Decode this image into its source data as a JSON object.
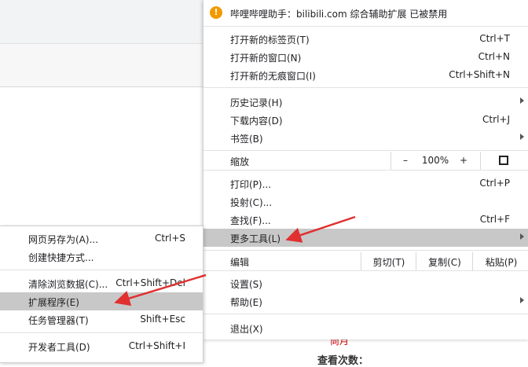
{
  "warning": {
    "text": "哔哩哔哩助手：bilibili.com 综合辅助扩展 已被禁用"
  },
  "menu": {
    "new_tab": {
      "label": "打开新的标签页(T)",
      "shortcut": "Ctrl+T"
    },
    "new_window": {
      "label": "打开新的窗口(N)",
      "shortcut": "Ctrl+N"
    },
    "new_incognito": {
      "label": "打开新的无痕窗口(I)",
      "shortcut": "Ctrl+Shift+N"
    },
    "history": {
      "label": "历史记录(H)"
    },
    "downloads": {
      "label": "下载内容(D)",
      "shortcut": "Ctrl+J"
    },
    "bookmarks": {
      "label": "书签(B)"
    },
    "zoom": {
      "label": "缩放",
      "minus": "–",
      "value": "100%",
      "plus": "+"
    },
    "print": {
      "label": "打印(P)...",
      "shortcut": "Ctrl+P"
    },
    "cast": {
      "label": "投射(C)..."
    },
    "find": {
      "label": "查找(F)...",
      "shortcut": "Ctrl+F"
    },
    "more_tools": {
      "label": "更多工具(L)"
    },
    "edit": {
      "label": "编辑",
      "cut": "剪切(T)",
      "copy": "复制(C)",
      "paste": "粘贴(P)"
    },
    "settings": {
      "label": "设置(S)"
    },
    "help": {
      "label": "帮助(E)"
    },
    "exit": {
      "label": "退出(X)"
    }
  },
  "submenu": {
    "save_page": {
      "label": "网页另存为(A)...",
      "shortcut": "Ctrl+S"
    },
    "create_shortcut": {
      "label": "创建快捷方式..."
    },
    "clear_data": {
      "label": "清除浏览数据(C)...",
      "shortcut": "Ctrl+Shift+Del"
    },
    "extensions": {
      "label": "扩展程序(E)"
    },
    "task_manager": {
      "label": "任务管理器(T)",
      "shortcut": "Shift+Esc"
    },
    "dev_tools": {
      "label": "开发者工具(D)",
      "shortcut": "Ctrl+Shift+I"
    }
  },
  "background": {
    "line1": "尚月",
    "line2": "查看次数："
  },
  "colors": {
    "highlight": "#c8c8c8",
    "warning": "#f29900",
    "arrow": "#e03030"
  }
}
